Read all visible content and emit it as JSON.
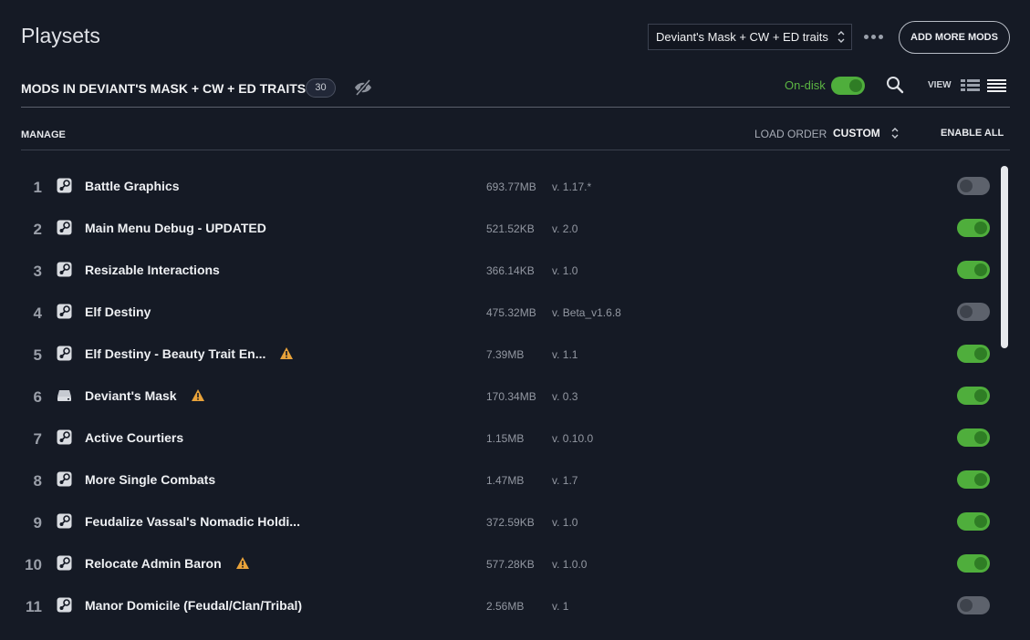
{
  "header": {
    "title": "Playsets",
    "playset_selected": "Deviant's Mask + CW + ED traits",
    "add_more_mods": "ADD MORE MODS"
  },
  "subheader": {
    "mods_title": "MODS IN DEVIANT'S MASK + CW + ED TRAITS",
    "mod_count": "30",
    "ondisk_label": "On-disk",
    "ondisk_enabled": true,
    "view_label": "VIEW"
  },
  "toolbar": {
    "manage": "MANAGE",
    "load_order_label": "LOAD ORDER",
    "load_order_value": "CUSTOM",
    "enable_all": "ENABLE ALL"
  },
  "colors": {
    "background": "#151a25",
    "toggle_on": "#4fae3c",
    "warning": "#e8a23a",
    "ondisk_text": "#5cb543"
  },
  "mods": [
    {
      "num": "1",
      "name": "Battle Graphics",
      "source_icon": "steam-icon",
      "warning": false,
      "size": "693.77MB",
      "version": "v. 1.17.*",
      "enabled": false
    },
    {
      "num": "2",
      "name": "Main Menu Debug - UPDATED",
      "source_icon": "steam-icon",
      "warning": false,
      "size": "521.52KB",
      "version": "v. 2.0",
      "enabled": true
    },
    {
      "num": "3",
      "name": "Resizable Interactions",
      "source_icon": "steam-icon",
      "warning": false,
      "size": "366.14KB",
      "version": "v. 1.0",
      "enabled": true
    },
    {
      "num": "4",
      "name": "Elf Destiny",
      "source_icon": "steam-icon",
      "warning": false,
      "size": "475.32MB",
      "version": "v. Beta_v1.6.8",
      "enabled": false
    },
    {
      "num": "5",
      "name": "Elf Destiny - Beauty Trait En...",
      "source_icon": "steam-icon",
      "warning": true,
      "size": "7.39MB",
      "version": "v. 1.1",
      "enabled": true
    },
    {
      "num": "6",
      "name": "Deviant's Mask",
      "source_icon": "local-drive-icon",
      "warning": true,
      "size": "170.34MB",
      "version": "v. 0.3",
      "enabled": true
    },
    {
      "num": "7",
      "name": "Active Courtiers",
      "source_icon": "steam-icon",
      "warning": false,
      "size": "1.15MB",
      "version": "v. 0.10.0",
      "enabled": true
    },
    {
      "num": "8",
      "name": "More Single Combats",
      "source_icon": "steam-icon",
      "warning": false,
      "size": "1.47MB",
      "version": "v. 1.7",
      "enabled": true
    },
    {
      "num": "9",
      "name": "Feudalize Vassal's Nomadic Holdi...",
      "source_icon": "steam-icon",
      "warning": false,
      "size": "372.59KB",
      "version": "v. 1.0",
      "enabled": true
    },
    {
      "num": "10",
      "name": "Relocate Admin Baron",
      "source_icon": "steam-icon",
      "warning": true,
      "size": "577.28KB",
      "version": "v. 1.0.0",
      "enabled": true
    },
    {
      "num": "11",
      "name": "Manor Domicile (Feudal/Clan/Tribal)",
      "source_icon": "steam-icon",
      "warning": false,
      "size": "2.56MB",
      "version": "v. 1",
      "enabled": false
    }
  ]
}
